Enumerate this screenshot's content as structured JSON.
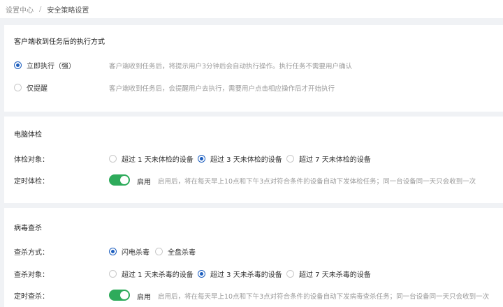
{
  "breadcrumb": {
    "parent": "设置中心",
    "separator": "/",
    "current": "安全策略设置"
  },
  "execution": {
    "title": "客户端收到任务后的执行方式",
    "options": [
      {
        "label": "立即执行（强）",
        "desc": "客户端收到任务后，将提示用户3分钟后会自动执行操作。执行任务不需要用户确认",
        "checked": true
      },
      {
        "label": "仅提醒",
        "desc": "客户端收到任务后，会提醒用户去执行，需要用户点击相应操作后才开始执行",
        "checked": false
      }
    ]
  },
  "checkup": {
    "title": "电脑体检",
    "target_label": "体检对象：",
    "target_options": [
      {
        "label": "超过 1 天未体检的设备",
        "checked": false
      },
      {
        "label": "超过 3 天未体检的设备",
        "checked": true
      },
      {
        "label": "超过 7 天未体检的设备",
        "checked": false
      }
    ],
    "schedule_label": "定时体检：",
    "schedule_toggle": "启用",
    "schedule_enabled": true,
    "schedule_desc": "启用后，将在每天早上10点和下午3点对符合条件的设备自动下发体检任务；同一台设备同一天只会收到一次"
  },
  "antivirus": {
    "title": "病毒查杀",
    "mode_label": "查杀方式：",
    "mode_options": [
      {
        "label": "闪电杀毒",
        "checked": true
      },
      {
        "label": "全盘杀毒",
        "checked": false
      }
    ],
    "target_label": "查杀对象：",
    "target_options": [
      {
        "label": "超过 1 天未杀毒的设备",
        "checked": false
      },
      {
        "label": "超过 3 天未杀毒的设备",
        "checked": true
      },
      {
        "label": "超过 7 天未杀毒的设备",
        "checked": false
      }
    ],
    "schedule_label": "定时查杀：",
    "schedule_toggle": "启用",
    "schedule_enabled": true,
    "schedule_desc": "启用后，将在每天早上10点和下午3点对符合条件的设备自动下发病毒查杀任务；同一台设备同一天只会收到一次"
  },
  "colors": {
    "accent": "#1e5fbf",
    "switch_on": "#2eab5b",
    "background": "#f0f2f5"
  }
}
